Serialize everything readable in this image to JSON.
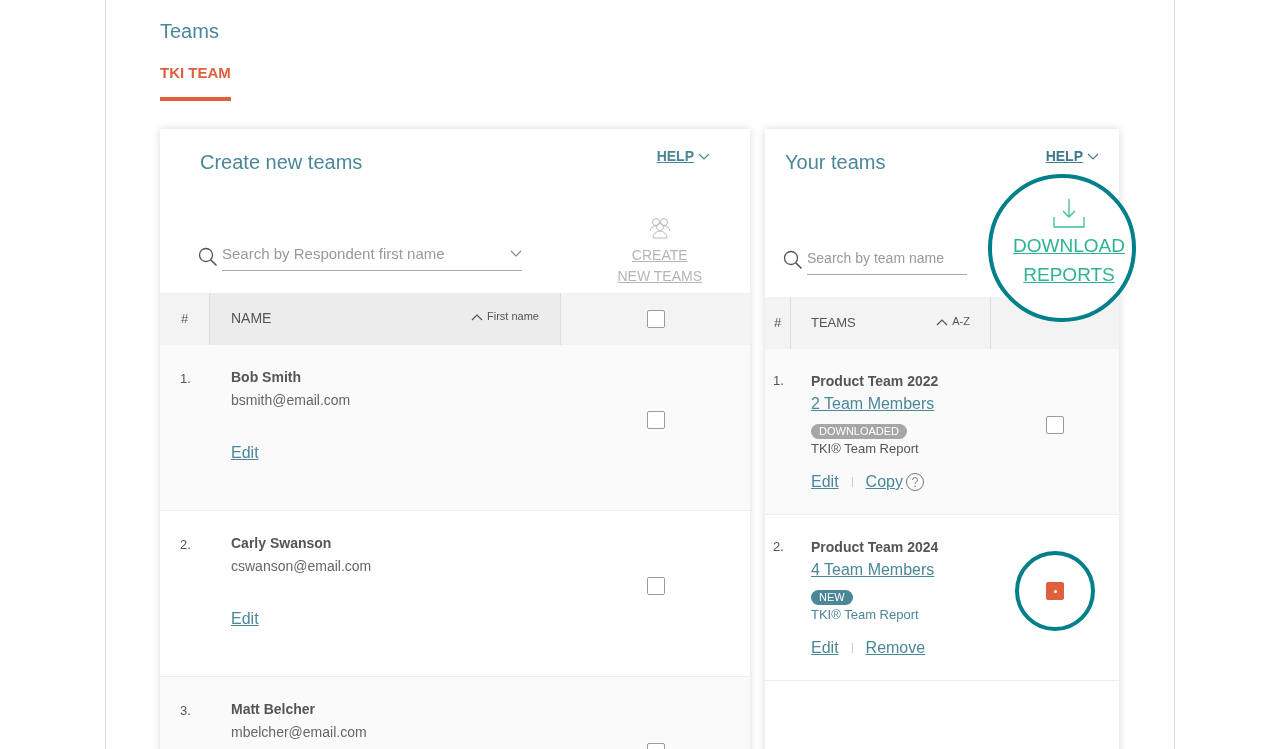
{
  "page_title": "Teams",
  "tabs": [
    {
      "label": "TKI TEAM",
      "selected": true
    }
  ],
  "create_panel": {
    "title": "Create new teams",
    "help": "HELP",
    "search": {
      "placeholder": "Search by Respondent first name"
    },
    "create_button": [
      "CREATE",
      "NEW TEAMS"
    ],
    "columns": [
      "#",
      "NAME"
    ],
    "sort": "First name",
    "select_all": {
      "checked": false
    },
    "rows": [
      {
        "number": "1.",
        "name": "Bob Smith",
        "email": "bsmith@email.com",
        "action": "Edit",
        "checked": false
      },
      {
        "number": "2.",
        "name": "Carly Swanson",
        "email": "cswanson@email.com",
        "action": "Edit",
        "checked": false
      },
      {
        "number": "3.",
        "name": "Matt Belcher",
        "email": "mbelcher@email.com",
        "checked": false
      }
    ]
  },
  "teams_panel": {
    "title": "Your teams",
    "help": "HELP",
    "search": {
      "placeholder": "Search by team name"
    },
    "download_button": [
      "DOWNLOAD",
      "REPORTS"
    ],
    "columns": [
      "#",
      "TEAMS"
    ],
    "sort": "A-Z",
    "rows": [
      {
        "number": "1.",
        "name": "Product Team 2022",
        "members": "2 Team Members",
        "badge": {
          "kind": "downloaded",
          "label": "DOWNLOADED"
        },
        "report": "TKI® Team Report",
        "actions": [
          {
            "label": "Edit",
            "help": false
          },
          {
            "label": "Copy",
            "help": true
          }
        ],
        "checked": false,
        "highlighted": false
      },
      {
        "number": "2.",
        "name": "Product Team 2024",
        "members": "4 Team Members",
        "badge": {
          "kind": "new",
          "label": "NEW"
        },
        "report": "TKI® Team Report",
        "actions": [
          {
            "label": "Edit",
            "help": false
          },
          {
            "label": "Remove",
            "help": false
          }
        ],
        "checked": true,
        "highlighted": true
      }
    ]
  }
}
